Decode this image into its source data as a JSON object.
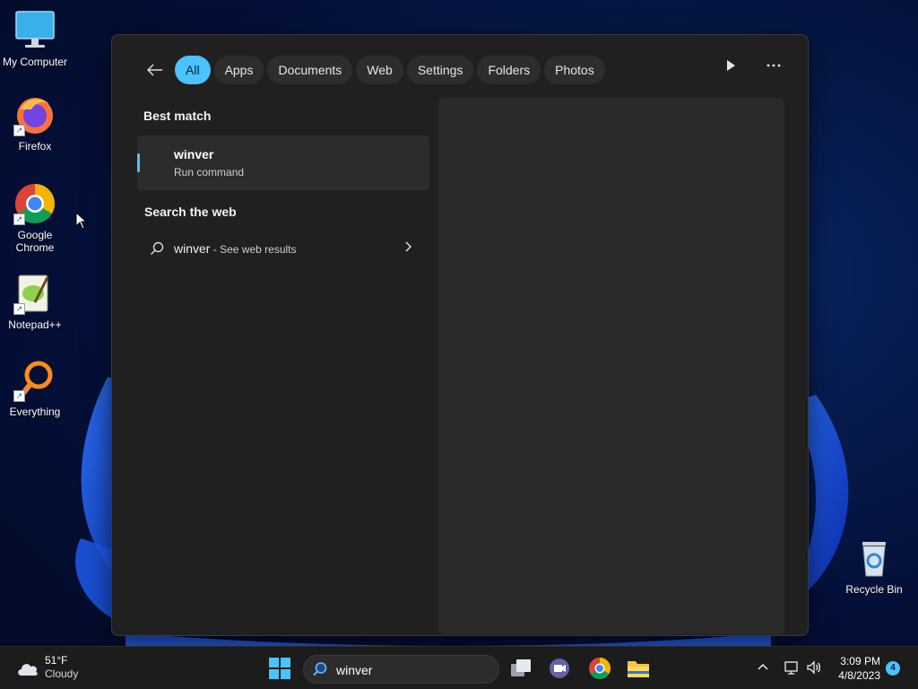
{
  "desktop": {
    "icons": [
      {
        "label": "My Computer",
        "icon": "monitor-icon"
      },
      {
        "label": "Firefox",
        "icon": "firefox-icon"
      },
      {
        "label": "Google Chrome",
        "icon": "chrome-icon"
      },
      {
        "label": "Notepad++",
        "icon": "notepadpp-icon"
      },
      {
        "label": "Everything",
        "icon": "everything-icon"
      },
      {
        "label": "Recycle Bin",
        "icon": "recycle-bin-icon"
      }
    ]
  },
  "search_panel": {
    "tabs": [
      "All",
      "Apps",
      "Documents",
      "Web",
      "Settings",
      "Folders",
      "Photos"
    ],
    "active_tab": "All",
    "best_match_label": "Best match",
    "best_match": {
      "title": "winver",
      "subtitle": "Run command"
    },
    "search_web_label": "Search the web",
    "web_result": {
      "query": "winver",
      "suffix": " - See web results"
    }
  },
  "taskbar": {
    "weather": {
      "temp": "51°F",
      "condition": "Cloudy"
    },
    "search_value": "winver",
    "clock": {
      "time": "3:09 PM",
      "date": "4/8/2023"
    },
    "notification_count": "4"
  },
  "colors": {
    "accent": "#4cc2ff",
    "panel": "#202020",
    "taskbar": "#1c1c1c"
  }
}
